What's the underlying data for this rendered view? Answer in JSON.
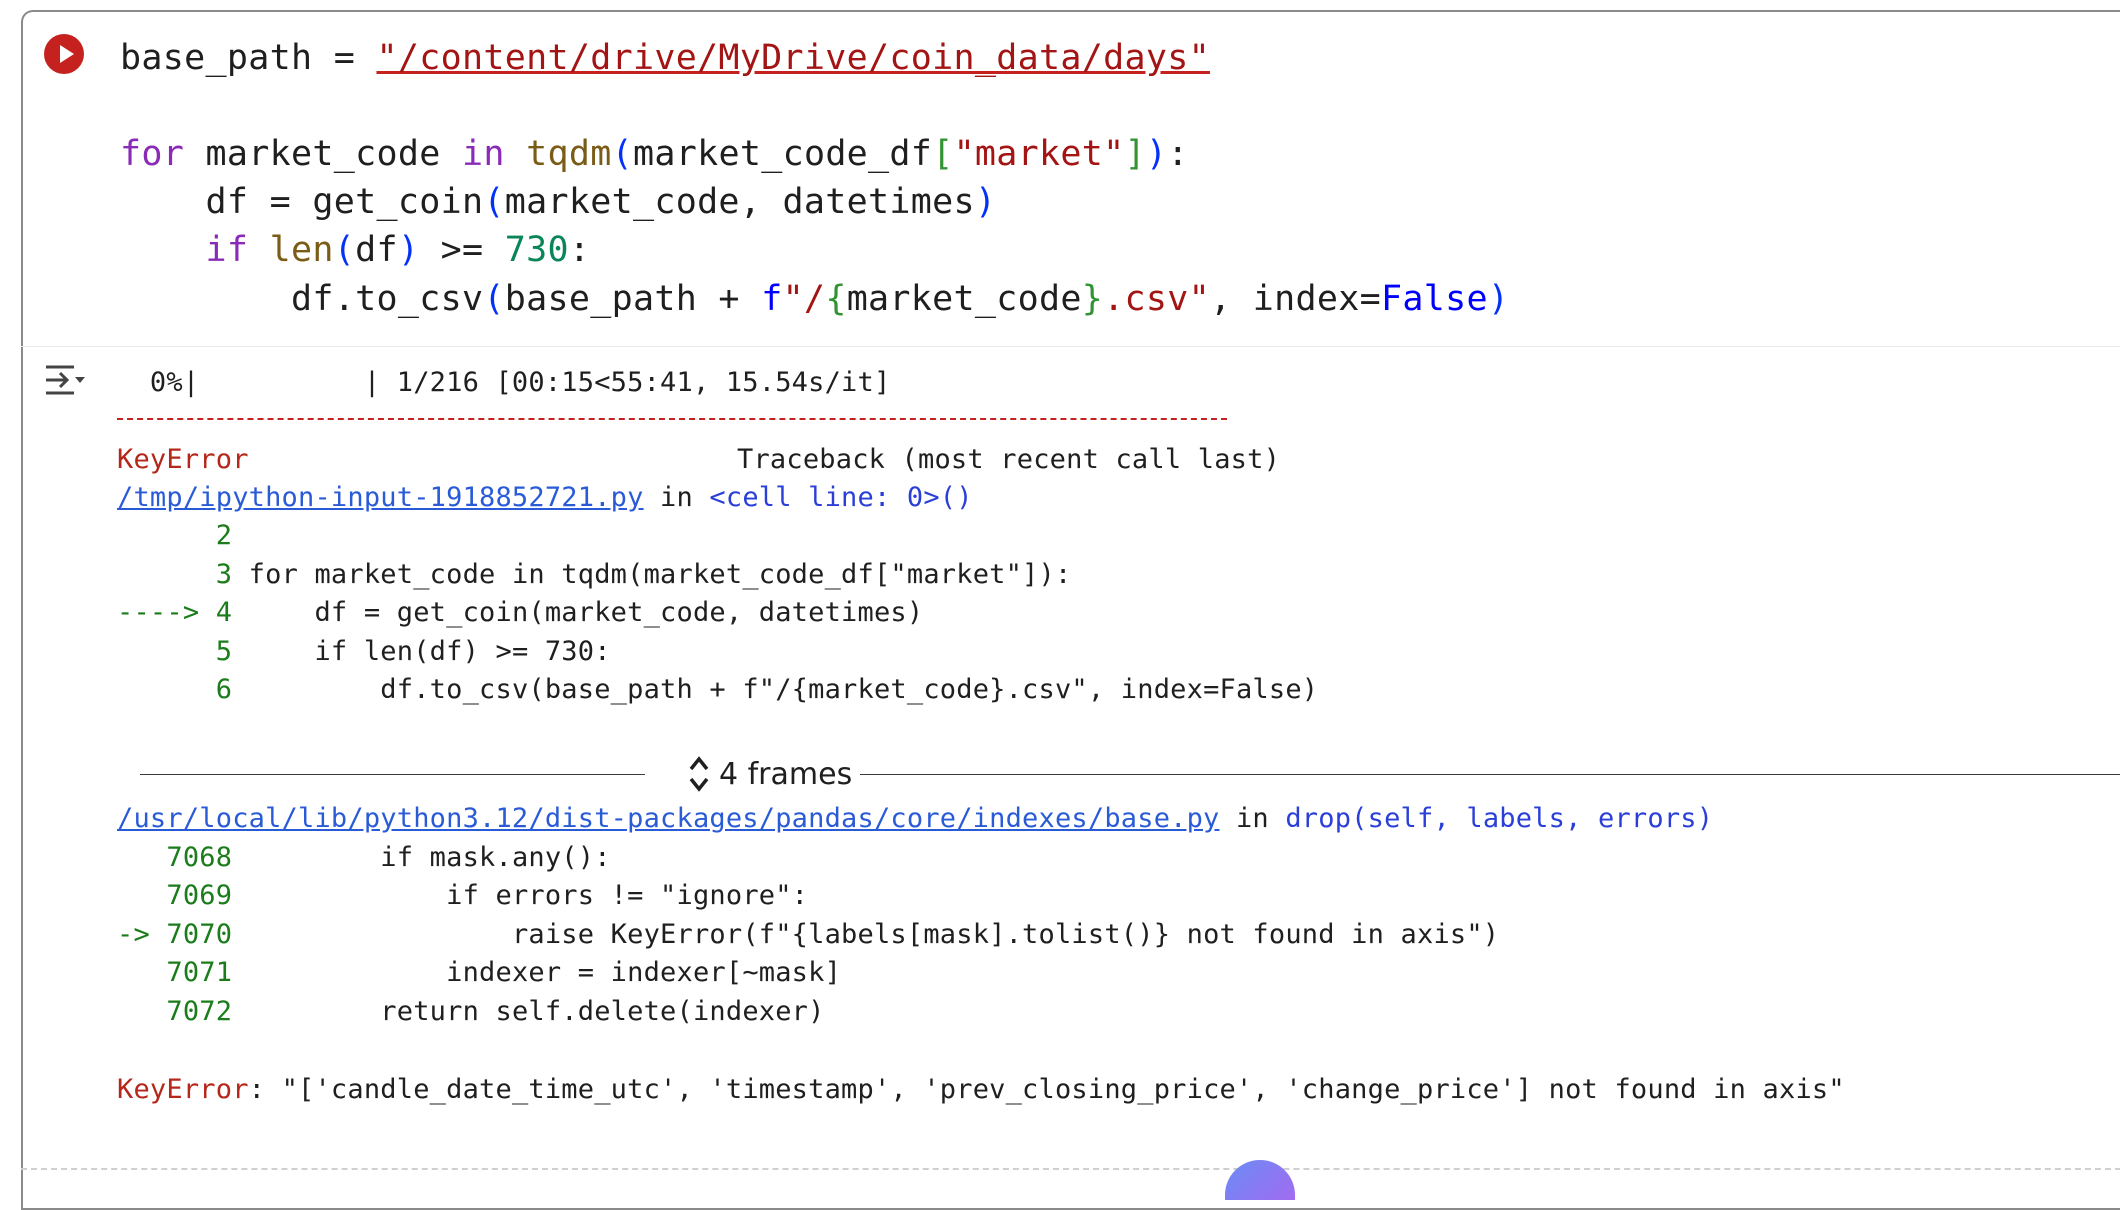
{
  "code_cell": {
    "base_path_var": "base_path",
    "assign": " = ",
    "base_path_value": "\"/content/drive/MyDrive/coin_data/days\"",
    "l2_for": "for",
    "l2_var": " market_code ",
    "l2_in": "in",
    "l2_sp": " ",
    "l2_tqdm": "tqdm",
    "l2_open": "(",
    "l2_df": "market_code_df",
    "l2_br_open": "[",
    "l2_key": "\"market\"",
    "l2_br_close": "]",
    "l2_close": ")",
    "l2_colon": ":",
    "l3_indent": "    ",
    "l3_df": "df = ",
    "l3_fn": "get_coin",
    "l3_open": "(",
    "l3_args": "market_code, datetimes",
    "l3_close": ")",
    "l4_indent": "    ",
    "l4_if": "if",
    "l4_sp": " ",
    "l4_len": "len",
    "l4_open": "(",
    "l4_arg": "df",
    "l4_close": ")",
    "l4_op": " >= ",
    "l4_num": "730",
    "l4_colon": ":",
    "l5_indent": "        ",
    "l5_call": "df.to_csv",
    "l5_open": "(",
    "l5_arg1": "base_path + ",
    "l5_f": "f",
    "l5_q1": "\"/",
    "l5_b1": "{",
    "l5_var": "market_code",
    "l5_b2": "}",
    "l5_ext": ".csv\"",
    "l5_comma": ", index=",
    "l5_false": "False",
    "l5_close": ")"
  },
  "output": {
    "progress_pct": "  0%|",
    "progress_rest": "          | 1/216 [00:15<55:41, 15.54s/it]",
    "error_name": "KeyError",
    "traceback_label": "Traceback (most recent call last)",
    "file1_link": "/tmp/ipython-input-1918852721.py",
    "file1_in": " in ",
    "file1_ctx": "<cell line: 0>",
    "file1_paren": "()",
    "tb1": [
      {
        "num": "      2",
        "code": ""
      },
      {
        "num": "      3",
        "code": " for market_code in tqdm(market_code_df[\"market\"]):"
      },
      {
        "num": "----> 4",
        "code": "     df = get_coin(market_code, datetimes)"
      },
      {
        "num": "      5",
        "code": "     if len(df) >= 730:"
      },
      {
        "num": "      6",
        "code": "         df.to_csv(base_path + f\"/{market_code}.csv\", index=False)"
      }
    ],
    "frames_label": "4 frames",
    "file2_link": "/usr/local/lib/python3.12/dist-packages/pandas/core/indexes/base.py",
    "file2_in": " in ",
    "file2_fn": "drop",
    "file2_args": "(self, labels, errors)",
    "tb2": [
      {
        "num": "   7068",
        "code": "         if mask.any():"
      },
      {
        "num": "   7069",
        "code": "             if errors != \"ignore\":"
      },
      {
        "num": "-> 7070",
        "code": "                 raise KeyError(f\"{labels[mask].tolist()} not found in axis\")"
      },
      {
        "num": "   7071",
        "code": "             indexer = indexer[~mask]"
      },
      {
        "num": "   7072",
        "code": "         return self.delete(indexer)"
      }
    ],
    "final_error_name": "KeyError",
    "final_error_msg": ": \"['candle_date_time_utc', 'timestamp', 'prev_closing_price', 'change_price'] not found in axis\""
  },
  "icons": {
    "run": "run-cell-icon",
    "output_toggle": "output-toggle-icon",
    "frames": "expand-collapse-icon"
  },
  "colors": {
    "run_button": "#c5221f",
    "error": "#b5271a",
    "keyword": "#8a2bb8",
    "string": "#a31515"
  }
}
